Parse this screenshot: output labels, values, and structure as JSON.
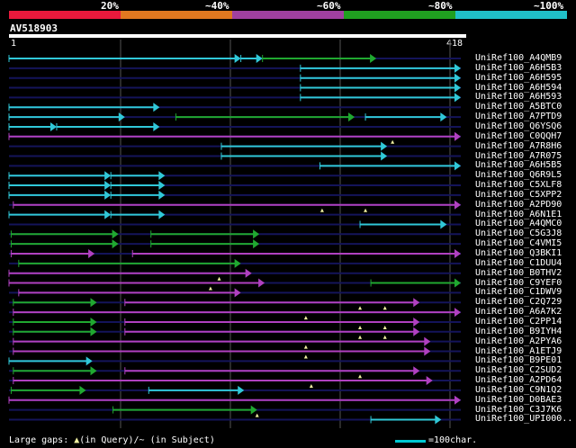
{
  "colors": {
    "bg": "#000000",
    "legend": [
      "#e8193c",
      "#e07820",
      "#a040a0",
      "#20a020",
      "#20c0c8"
    ],
    "low": "#b040c0",
    "mid": "#20a830",
    "high": "#30c8d8",
    "empty": "#14145a",
    "grid": "#555555",
    "gap": "#f0f0a0"
  },
  "legend_labels": [
    "20%",
    "~40%",
    "~60%",
    "~80%",
    "~100%"
  ],
  "query": {
    "name": "AV518903",
    "start": "1",
    "end": "418",
    "length": 418
  },
  "hits": [
    {
      "name": "UniRef100_A4QMB9",
      "segs": [
        [
          1,
          215,
          "high"
        ],
        [
          215,
          235,
          "high"
        ],
        [
          235,
          340,
          "mid"
        ]
      ],
      "gaps": []
    },
    {
      "name": "UniRef100_A6H5B3",
      "segs": [
        [
          270,
          418,
          "high"
        ]
      ],
      "gaps": []
    },
    {
      "name": "UniRef100_A6H595",
      "segs": [
        [
          270,
          418,
          "high"
        ]
      ],
      "gaps": []
    },
    {
      "name": "UniRef100_A6H594",
      "segs": [
        [
          270,
          418,
          "high"
        ]
      ],
      "gaps": []
    },
    {
      "name": "UniRef100_A6H593",
      "segs": [
        [
          270,
          418,
          "high"
        ]
      ],
      "gaps": []
    },
    {
      "name": "UniRef100_A5BTC0",
      "segs": [
        [
          1,
          140,
          "high"
        ]
      ],
      "gaps": []
    },
    {
      "name": "UniRef100_A7PTD9",
      "segs": [
        [
          1,
          108,
          "high"
        ],
        [
          155,
          320,
          "mid"
        ],
        [
          330,
          405,
          "high"
        ]
      ],
      "gaps": []
    },
    {
      "name": "UniRef100_Q6YSQ6",
      "segs": [
        [
          1,
          45,
          "high"
        ],
        [
          45,
          140,
          "high"
        ]
      ],
      "gaps": []
    },
    {
      "name": "UniRef100_C0QQH7",
      "segs": [
        [
          1,
          418,
          "low"
        ]
      ],
      "gaps": [
        355
      ]
    },
    {
      "name": "UniRef100_A7R8H6",
      "segs": [
        [
          197,
          350,
          "high"
        ]
      ],
      "gaps": []
    },
    {
      "name": "UniRef100_A7R075",
      "segs": [
        [
          197,
          350,
          "high"
        ]
      ],
      "gaps": []
    },
    {
      "name": "UniRef100_A6H5B5",
      "segs": [
        [
          288,
          418,
          "high"
        ]
      ],
      "gaps": []
    },
    {
      "name": "UniRef100_Q6R9L5",
      "segs": [
        [
          1,
          95,
          "high"
        ],
        [
          95,
          145,
          "high"
        ]
      ],
      "gaps": []
    },
    {
      "name": "UniRef100_C5XLF8",
      "segs": [
        [
          1,
          95,
          "high"
        ],
        [
          95,
          145,
          "high"
        ]
      ],
      "gaps": []
    },
    {
      "name": "UniRef100_C5XPP2",
      "segs": [
        [
          1,
          95,
          "high"
        ],
        [
          95,
          145,
          "high"
        ]
      ],
      "gaps": []
    },
    {
      "name": "UniRef100_A2PD90",
      "segs": [
        [
          5,
          418,
          "low"
        ]
      ],
      "gaps": [
        290,
        330
      ]
    },
    {
      "name": "UniRef100_A6N1E1",
      "segs": [
        [
          1,
          95,
          "high"
        ],
        [
          95,
          145,
          "high"
        ]
      ],
      "gaps": []
    },
    {
      "name": "UniRef100_A4QMC0",
      "segs": [
        [
          325,
          405,
          "high"
        ]
      ],
      "gaps": []
    },
    {
      "name": "UniRef100_C5G3J8",
      "segs": [
        [
          3,
          102,
          "mid"
        ],
        [
          132,
          232,
          "mid"
        ]
      ],
      "gaps": []
    },
    {
      "name": "UniRef100_C4VMI5",
      "segs": [
        [
          3,
          102,
          "mid"
        ],
        [
          132,
          232,
          "mid"
        ]
      ],
      "gaps": []
    },
    {
      "name": "UniRef100_Q3BKI1",
      "segs": [
        [
          3,
          80,
          "low"
        ],
        [
          115,
          418,
          "low"
        ]
      ],
      "gaps": []
    },
    {
      "name": "UniRef100_C1DUU4",
      "segs": [
        [
          10,
          215,
          "mid"
        ]
      ],
      "gaps": []
    },
    {
      "name": "UniRef100_B0THV2",
      "segs": [
        [
          1,
          225,
          "low"
        ]
      ],
      "gaps": [
        195
      ]
    },
    {
      "name": "UniRef100_C9YEF0",
      "segs": [
        [
          1,
          237,
          "low"
        ],
        [
          335,
          418,
          "mid"
        ]
      ],
      "gaps": [
        187
      ]
    },
    {
      "name": "UniRef100_C1DWV9",
      "segs": [
        [
          10,
          215,
          "low"
        ]
      ],
      "gaps": []
    },
    {
      "name": "UniRef100_C2Q729",
      "segs": [
        [
          5,
          82,
          "mid"
        ],
        [
          108,
          380,
          "low"
        ]
      ],
      "gaps": [
        325,
        348
      ]
    },
    {
      "name": "UniRef100_A6A7K2",
      "segs": [
        [
          5,
          418,
          "low"
        ]
      ],
      "gaps": [
        275
      ]
    },
    {
      "name": "UniRef100_C2PP14",
      "segs": [
        [
          5,
          82,
          "mid"
        ],
        [
          108,
          380,
          "low"
        ]
      ],
      "gaps": [
        325,
        348
      ]
    },
    {
      "name": "UniRef100_B9IYH4",
      "segs": [
        [
          5,
          82,
          "mid"
        ],
        [
          108,
          380,
          "low"
        ]
      ],
      "gaps": [
        325,
        348
      ]
    },
    {
      "name": "UniRef100_A2PYA6",
      "segs": [
        [
          5,
          390,
          "low"
        ]
      ],
      "gaps": [
        275
      ]
    },
    {
      "name": "UniRef100_A1ETJ9",
      "segs": [
        [
          5,
          390,
          "low"
        ]
      ],
      "gaps": [
        275
      ]
    },
    {
      "name": "UniRef100_B9PE01",
      "segs": [
        [
          1,
          78,
          "high"
        ]
      ],
      "gaps": []
    },
    {
      "name": "UniRef100_C2SUD2",
      "segs": [
        [
          5,
          82,
          "mid"
        ],
        [
          108,
          380,
          "low"
        ]
      ],
      "gaps": [
        325
      ]
    },
    {
      "name": "UniRef100_A2PD64",
      "segs": [
        [
          5,
          392,
          "low"
        ]
      ],
      "gaps": [
        280
      ]
    },
    {
      "name": "UniRef100_C9N1Q2",
      "segs": [
        [
          3,
          72,
          "mid"
        ],
        [
          130,
          218,
          "high"
        ]
      ],
      "gaps": []
    },
    {
      "name": "UniRef100_D0BAE3",
      "segs": [
        [
          1,
          418,
          "low"
        ]
      ],
      "gaps": []
    },
    {
      "name": "UniRef100_C3J7K6",
      "segs": [
        [
          97,
          230,
          "mid"
        ]
      ],
      "gaps": [
        230
      ]
    },
    {
      "name": "UniRef100_UPI000..",
      "segs": [
        [
          335,
          400,
          "high"
        ]
      ],
      "gaps": []
    }
  ],
  "footer": {
    "left_prefix": "Large gaps:",
    "left_query": "(in Query)/",
    "left_dash": "~",
    "left_subject": "(in Subject)",
    "right": "=100char."
  }
}
